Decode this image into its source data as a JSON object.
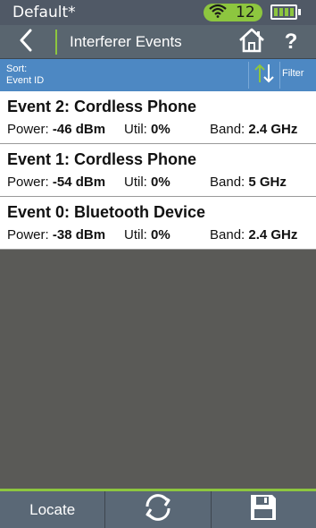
{
  "status_bar": {
    "profile_name": "Default*",
    "wifi_count": "12",
    "icons": {
      "wifi": "wifi-icon",
      "battery": "battery-icon"
    }
  },
  "title_bar": {
    "title": "Interferer Events",
    "icons": {
      "back": "chevron-left-icon",
      "home": "home-icon",
      "help": "question-mark-icon"
    },
    "help_label": "?"
  },
  "sort_bar": {
    "sort_label": "Sort:",
    "sort_value": "Event ID",
    "filter_label": "Filter",
    "icons": {
      "sort": "sort-arrows-icon"
    }
  },
  "events": [
    {
      "title": "Event 2: Cordless Phone",
      "power_label": "Power:",
      "power_value": "-46 dBm",
      "util_label": "Util:",
      "util_value": "0%",
      "band_label": "Band:",
      "band_value": "2.4 GHz"
    },
    {
      "title": "Event 1: Cordless Phone",
      "power_label": "Power:",
      "power_value": "-54 dBm",
      "util_label": "Util:",
      "util_value": "0%",
      "band_label": "Band:",
      "band_value": "5 GHz"
    },
    {
      "title": "Event 0: Bluetooth Device",
      "power_label": "Power:",
      "power_value": "-38 dBm",
      "util_label": "Util:",
      "util_value": "0%",
      "band_label": "Band:",
      "band_value": "2.4 GHz"
    }
  ],
  "bottom_bar": {
    "locate_label": "Locate",
    "icons": {
      "refresh": "refresh-icon",
      "save": "save-icon"
    }
  },
  "colors": {
    "accent_green": "#8dc63f",
    "sort_bar_blue": "#4d88c3",
    "header_gray": "#59656f",
    "background": "#5a5a57"
  }
}
